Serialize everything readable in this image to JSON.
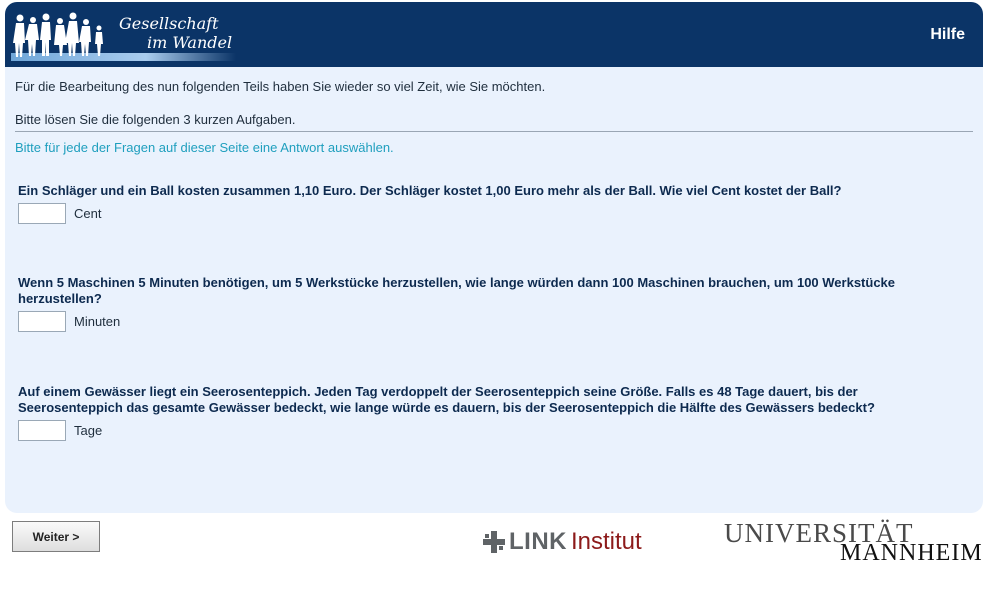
{
  "header": {
    "logo_line1": "Gesellschaft",
    "logo_line2": "im Wandel",
    "help_label": "Hilfe"
  },
  "intro": {
    "line1": "Für die Bearbeitung des nun folgenden Teils haben Sie wieder so viel Zeit, wie Sie möchten.",
    "line2": "Bitte lösen Sie die folgenden 3 kurzen Aufgaben."
  },
  "hint": "Bitte für jede der Fragen auf dieser Seite eine Antwort auswählen.",
  "questions": [
    {
      "text": "Ein Schläger und ein Ball kosten zusammen 1,10 Euro. Der Schläger kostet 1,00 Euro mehr als der Ball. Wie viel Cent kostet der Ball?",
      "value": "",
      "unit": "Cent"
    },
    {
      "text": "Wenn 5 Maschinen 5 Minuten benötigen, um 5 Werkstücke herzustellen, wie lange würden dann 100 Maschinen brauchen, um 100 Werkstücke herzustellen?",
      "value": "",
      "unit": "Minuten"
    },
    {
      "text": "Auf einem Gewässer liegt ein Seerosenteppich. Jeden Tag verdoppelt der Seerosenteppich seine Größe. Falls es 48 Tage dauert, bis der Seerosenteppich das gesamte Gewässer bedeckt, wie lange würde es dauern, bis der Seerosenteppich die Hälfte des Gewässers bedeckt?",
      "value": "",
      "unit": "Tage"
    }
  ],
  "footer": {
    "next_label": "Weiter >",
    "link_word": "LINK",
    "link_institut": "Institut",
    "uni_line1": "UNIVERSITÄT",
    "uni_line2": "MANNHEIM"
  },
  "colors": {
    "header_bg": "#0b3467",
    "card_bg": "#eaf2fd",
    "hint": "#1f9fbe",
    "link_red": "#8c1a1a"
  }
}
